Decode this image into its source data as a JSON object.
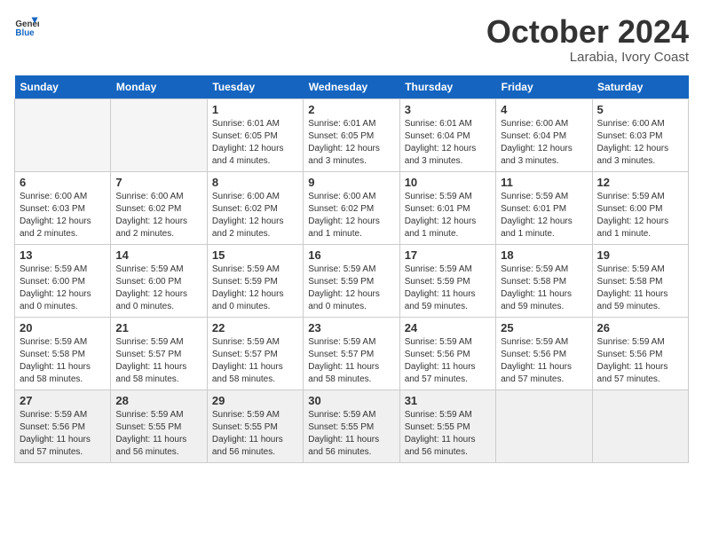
{
  "header": {
    "logo_line1": "General",
    "logo_line2": "Blue",
    "month": "October 2024",
    "location": "Larabia, Ivory Coast"
  },
  "weekdays": [
    "Sunday",
    "Monday",
    "Tuesday",
    "Wednesday",
    "Thursday",
    "Friday",
    "Saturday"
  ],
  "weeks": [
    [
      {
        "day": "",
        "info": ""
      },
      {
        "day": "",
        "info": ""
      },
      {
        "day": "1",
        "info": "Sunrise: 6:01 AM\nSunset: 6:05 PM\nDaylight: 12 hours\nand 4 minutes."
      },
      {
        "day": "2",
        "info": "Sunrise: 6:01 AM\nSunset: 6:05 PM\nDaylight: 12 hours\nand 3 minutes."
      },
      {
        "day": "3",
        "info": "Sunrise: 6:01 AM\nSunset: 6:04 PM\nDaylight: 12 hours\nand 3 minutes."
      },
      {
        "day": "4",
        "info": "Sunrise: 6:00 AM\nSunset: 6:04 PM\nDaylight: 12 hours\nand 3 minutes."
      },
      {
        "day": "5",
        "info": "Sunrise: 6:00 AM\nSunset: 6:03 PM\nDaylight: 12 hours\nand 3 minutes."
      }
    ],
    [
      {
        "day": "6",
        "info": "Sunrise: 6:00 AM\nSunset: 6:03 PM\nDaylight: 12 hours\nand 2 minutes."
      },
      {
        "day": "7",
        "info": "Sunrise: 6:00 AM\nSunset: 6:02 PM\nDaylight: 12 hours\nand 2 minutes."
      },
      {
        "day": "8",
        "info": "Sunrise: 6:00 AM\nSunset: 6:02 PM\nDaylight: 12 hours\nand 2 minutes."
      },
      {
        "day": "9",
        "info": "Sunrise: 6:00 AM\nSunset: 6:02 PM\nDaylight: 12 hours\nand 1 minute."
      },
      {
        "day": "10",
        "info": "Sunrise: 5:59 AM\nSunset: 6:01 PM\nDaylight: 12 hours\nand 1 minute."
      },
      {
        "day": "11",
        "info": "Sunrise: 5:59 AM\nSunset: 6:01 PM\nDaylight: 12 hours\nand 1 minute."
      },
      {
        "day": "12",
        "info": "Sunrise: 5:59 AM\nSunset: 6:00 PM\nDaylight: 12 hours\nand 1 minute."
      }
    ],
    [
      {
        "day": "13",
        "info": "Sunrise: 5:59 AM\nSunset: 6:00 PM\nDaylight: 12 hours\nand 0 minutes."
      },
      {
        "day": "14",
        "info": "Sunrise: 5:59 AM\nSunset: 6:00 PM\nDaylight: 12 hours\nand 0 minutes."
      },
      {
        "day": "15",
        "info": "Sunrise: 5:59 AM\nSunset: 5:59 PM\nDaylight: 12 hours\nand 0 minutes."
      },
      {
        "day": "16",
        "info": "Sunrise: 5:59 AM\nSunset: 5:59 PM\nDaylight: 12 hours\nand 0 minutes."
      },
      {
        "day": "17",
        "info": "Sunrise: 5:59 AM\nSunset: 5:59 PM\nDaylight: 11 hours\nand 59 minutes."
      },
      {
        "day": "18",
        "info": "Sunrise: 5:59 AM\nSunset: 5:58 PM\nDaylight: 11 hours\nand 59 minutes."
      },
      {
        "day": "19",
        "info": "Sunrise: 5:59 AM\nSunset: 5:58 PM\nDaylight: 11 hours\nand 59 minutes."
      }
    ],
    [
      {
        "day": "20",
        "info": "Sunrise: 5:59 AM\nSunset: 5:58 PM\nDaylight: 11 hours\nand 58 minutes."
      },
      {
        "day": "21",
        "info": "Sunrise: 5:59 AM\nSunset: 5:57 PM\nDaylight: 11 hours\nand 58 minutes."
      },
      {
        "day": "22",
        "info": "Sunrise: 5:59 AM\nSunset: 5:57 PM\nDaylight: 11 hours\nand 58 minutes."
      },
      {
        "day": "23",
        "info": "Sunrise: 5:59 AM\nSunset: 5:57 PM\nDaylight: 11 hours\nand 58 minutes."
      },
      {
        "day": "24",
        "info": "Sunrise: 5:59 AM\nSunset: 5:56 PM\nDaylight: 11 hours\nand 57 minutes."
      },
      {
        "day": "25",
        "info": "Sunrise: 5:59 AM\nSunset: 5:56 PM\nDaylight: 11 hours\nand 57 minutes."
      },
      {
        "day": "26",
        "info": "Sunrise: 5:59 AM\nSunset: 5:56 PM\nDaylight: 11 hours\nand 57 minutes."
      }
    ],
    [
      {
        "day": "27",
        "info": "Sunrise: 5:59 AM\nSunset: 5:56 PM\nDaylight: 11 hours\nand 57 minutes."
      },
      {
        "day": "28",
        "info": "Sunrise: 5:59 AM\nSunset: 5:55 PM\nDaylight: 11 hours\nand 56 minutes."
      },
      {
        "day": "29",
        "info": "Sunrise: 5:59 AM\nSunset: 5:55 PM\nDaylight: 11 hours\nand 56 minutes."
      },
      {
        "day": "30",
        "info": "Sunrise: 5:59 AM\nSunset: 5:55 PM\nDaylight: 11 hours\nand 56 minutes."
      },
      {
        "day": "31",
        "info": "Sunrise: 5:59 AM\nSunset: 5:55 PM\nDaylight: 11 hours\nand 56 minutes."
      },
      {
        "day": "",
        "info": ""
      },
      {
        "day": "",
        "info": ""
      }
    ]
  ]
}
